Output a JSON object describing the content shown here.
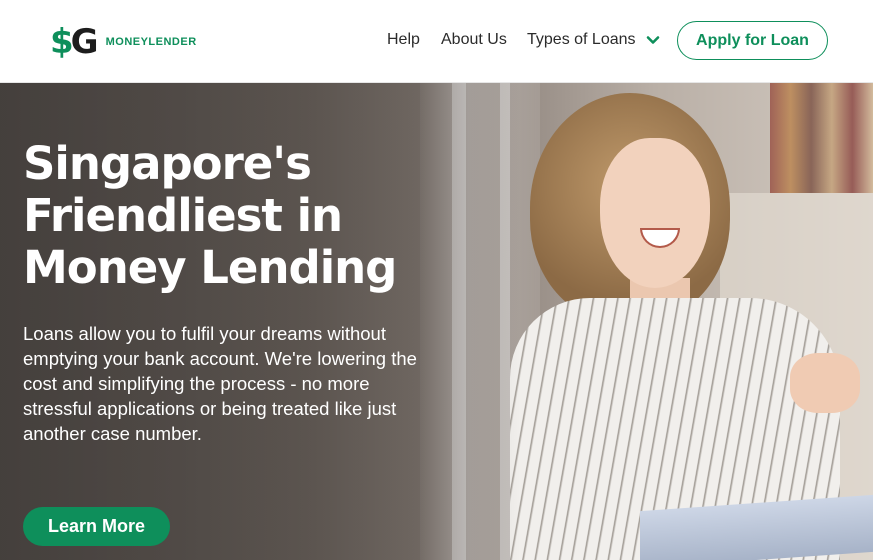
{
  "brand": {
    "logo_mark_dollar": "$",
    "logo_mark_g": "G",
    "logo_text": "MONEYLENDER",
    "primary_color": "#0e8f5b"
  },
  "nav": {
    "help": "Help",
    "about": "About Us",
    "types": "Types of Loans",
    "types_icon": "chevron-down-icon",
    "apply": "Apply for Loan"
  },
  "hero": {
    "title_line1": "Singapore's",
    "title_line2": "Friendliest in",
    "title_line3": "Money Lending",
    "description": "Loans allow you to fulfil your dreams without emptying your bank account. We're lowering the cost and simplifying the process - no more stressful applications or being treated like just another case number.",
    "cta": "Learn More"
  }
}
